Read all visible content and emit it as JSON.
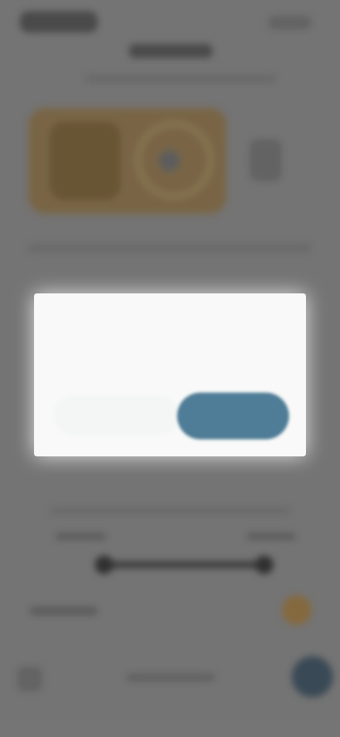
{
  "dialog": {
    "title": "",
    "message": "",
    "cancel_label": "",
    "confirm_label": ""
  }
}
